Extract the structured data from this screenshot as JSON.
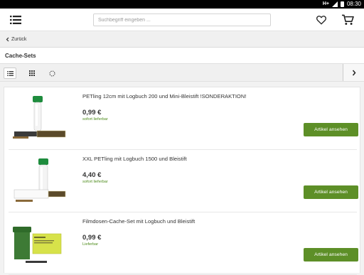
{
  "status": {
    "network": "H+",
    "time": "08:30"
  },
  "header": {
    "search_placeholder": "Suchbegriff eingeben ..."
  },
  "nav": {
    "back_label": "Zurück"
  },
  "page": {
    "title": "Cache-Sets"
  },
  "colors": {
    "accent": "#5d8f27",
    "availability": "#4e8c1c"
  },
  "products": [
    {
      "name": "PETling 12cm mit Logbuch 200 und Mini-Bleistift !SONDERAKTION!",
      "price": "0,99 €",
      "availability": "sofort lieferbar",
      "button": "Artikel ansehen"
    },
    {
      "name": "XXL PETling mit Logbuch 1500 und Bleistift",
      "price": "4,40 €",
      "availability": "sofort lieferbar",
      "button": "Artikel ansehen"
    },
    {
      "name": "Filmdosen-Cache-Set mit Logbuch und Bleistift",
      "price": "0,99 €",
      "availability": "Lieferbar",
      "button": "Artikel ansehen"
    }
  ]
}
